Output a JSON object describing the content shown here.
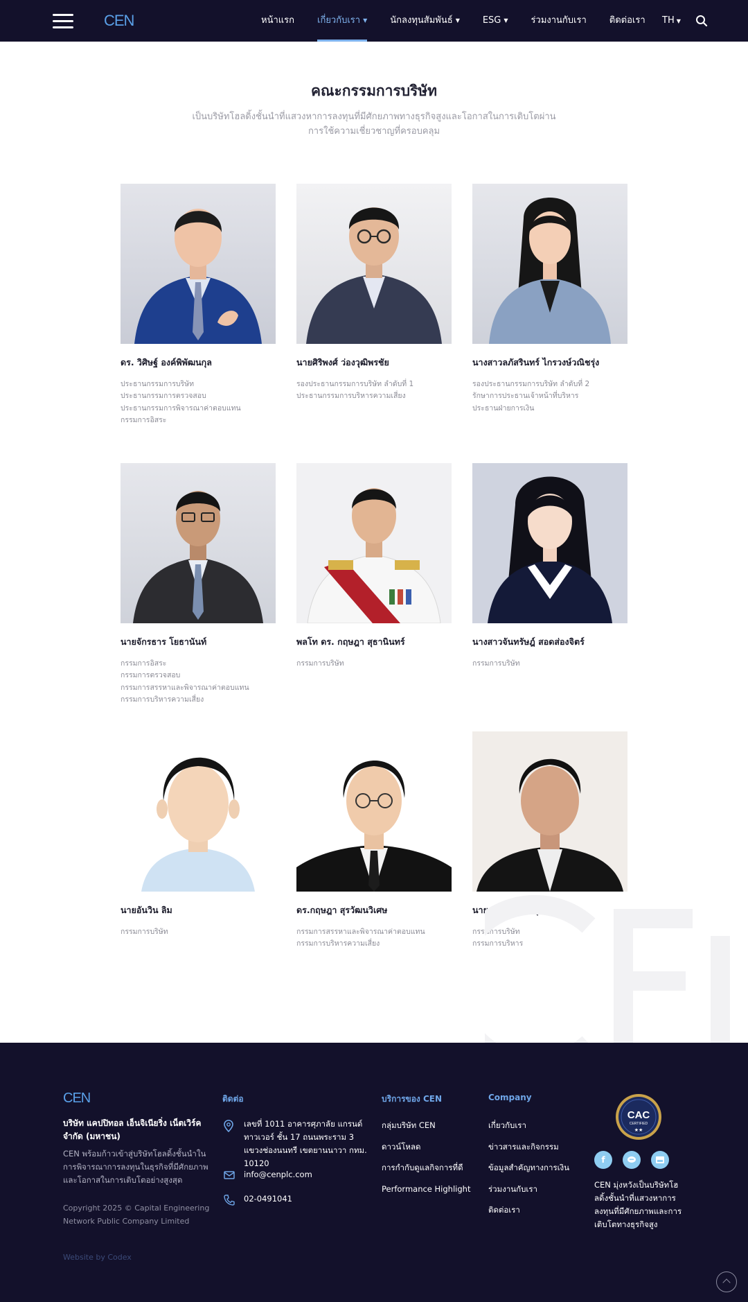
{
  "header": {
    "logo_text": "CEN",
    "nav": [
      {
        "label": "หน้าแรก",
        "dropdown": false,
        "active": false
      },
      {
        "label": "เกี่ยวกับเรา",
        "dropdown": true,
        "active": true
      },
      {
        "label": "นักลงทุนสัมพันธ์",
        "dropdown": true,
        "active": false
      },
      {
        "label": "ESG",
        "dropdown": true,
        "active": false
      },
      {
        "label": "ร่วมงานกับเรา",
        "dropdown": false,
        "active": false
      },
      {
        "label": "ติดต่อเรา",
        "dropdown": false,
        "active": false
      }
    ],
    "lang": "TH"
  },
  "section": {
    "title": "คณะกรรมการบริษัท",
    "subtitle": "เป็นบริษัทโฮลดิ้งชั้นนำที่แสวงหาการลงทุนที่มีศักยภาพทางธุรกิจสูงและโอกาสในการเติบโตผ่านการใช้ความเชี่ยวชาญที่ครอบคลุม"
  },
  "board": [
    {
      "name": "ดร. วิศิษฐ์ องค์พิพัฒนกุล",
      "roles": [
        "ประธานกรรมการบริษัท",
        "ประธานกรรมการตรวจสอบ",
        "ประธานกรรมการพิจารณาค่าตอบแทน",
        "กรรมการอิสระ"
      ]
    },
    {
      "name": "นายศิริพงศ์ ว่องวุฒิพรชัย",
      "roles": [
        "รองประธานกรรมการบริษัท ลำดับที่ 1",
        "ประธานกรรมการบริหารความเสี่ยง"
      ]
    },
    {
      "name": "นางสาวลภัสรินทร์ ไกรวงษ์วณิชรุ่ง",
      "roles": [
        "รองประธานกรรมการบริษัท ลำดับที่ 2",
        "รักษาการประธานเจ้าหน้าที่บริหาร",
        "ประธานฝ่ายการเงิน"
      ]
    },
    {
      "name": "นายจักรธาร โยธานันท์",
      "roles": [
        "กรรมการอิสระ",
        "กรรมการตรวจสอบ",
        "กรรมการสรรหาและพิจารณาค่าตอบแทน",
        "กรรมการบริหารความเสี่ยง"
      ]
    },
    {
      "name": "พลโท ดร. กฤษฎา สุธานินทร์",
      "roles": [
        "กรรมการบริษัท"
      ]
    },
    {
      "name": "นางสาวจันทรัษฎ์ สอดส่องจิตร์",
      "roles": [
        "กรรมการบริษัท"
      ]
    },
    {
      "name": "นายอันวิน ลิม",
      "roles": [
        "กรรมการบริษัท"
      ]
    },
    {
      "name": "ดร.กฤษฎา สุรวัฒนวิเศษ",
      "roles": [
        "กรรมการสรรหาและพิจารณาค่าตอบแทน",
        "กรรมการบริหารความเสี่ยง"
      ]
    },
    {
      "name": "นายอารักษ์ อ่อนสุภาพ",
      "roles": [
        "กรรมการบริษัท",
        "กรรมการบริหาร"
      ]
    }
  ],
  "footer": {
    "logo_text": "CEN",
    "company_name": "บริษัท แคปปิทอล เอ็นจิเนียริ่ง เน็ตเวิร์ค จำกัด (มหาชน)",
    "company_desc": "CEN พร้อมก้าวเข้าสู่บริษัทโฮลดิ้งชั้นนำในการพิจารณาการลงทุนในธุรกิจที่มีศักยภาพและโอกาสในการเติบโตอย่างสูงสุด",
    "copyright": "Copyright 2025 © Capital Engineering Network Public Company Limited",
    "credit": "Website by Codex",
    "contact_heading": "ติดต่อ",
    "address": "เลขที่ 1011 อาคารศุภาลัย แกรนด์ ทาวเวอร์ ชั้น 17 ถนนพระราม 3 แขวงช่องนนทรี เขตยานนาวา กทม. 10120",
    "email": "info@cenplc.com",
    "phone": "02-0491041",
    "services_heading": "บริการของ CEN",
    "services": [
      "กลุ่มบริษัท CEN",
      "ดาวน์โหลด",
      "การกำกับดูแลกิจการที่ดี",
      "Performance Highlight"
    ],
    "company_heading": "Company",
    "company_links": [
      "เกี่ยวกับเรา",
      "ข่าวสารและกิจกรรม",
      "ข้อมูลสำคัญทางการเงิน",
      "ร่วมงานกับเรา",
      "ติดต่อเรา"
    ],
    "badge_text": "CAC",
    "badge_sub": "CERTIFIED",
    "socials": [
      "facebook-icon",
      "line-icon",
      "shop-icon"
    ],
    "tagline": "CEN มุ่งหวังเป็นบริษัทโฮลดิ้งชั้นนำที่แสวงหาการลงทุนที่มีศักยภาพและการเติบโตทางธุรกิจสูง"
  },
  "colors": {
    "nav_bg": "#13112b",
    "accent": "#7fb3ee",
    "footer_heading": "#6fa6e8",
    "social": "#8fcdf1"
  }
}
